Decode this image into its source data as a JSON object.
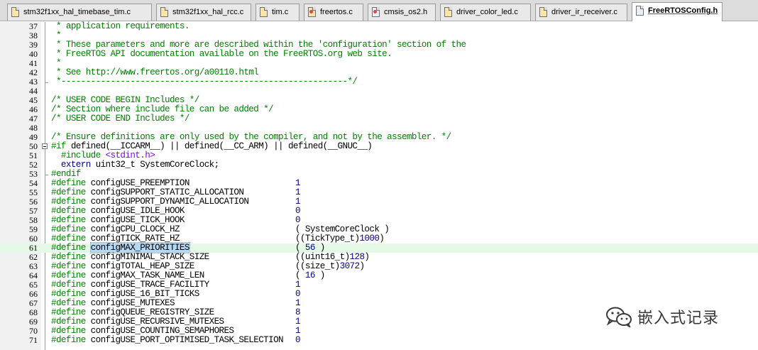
{
  "tabs": [
    {
      "label": "stm32f1xx_hal_timebase_tim.c",
      "type": "c",
      "pin": false,
      "active": false
    },
    {
      "label": "stm32f1xx_hal_rcc.c",
      "type": "c",
      "pin": false,
      "active": false
    },
    {
      "label": "tim.c",
      "type": "c",
      "pin": false,
      "active": false
    },
    {
      "label": "freertos.c",
      "type": "c",
      "pin": true,
      "active": false
    },
    {
      "label": "cmsis_os2.h",
      "type": "h",
      "pin": true,
      "active": false
    },
    {
      "label": "driver_color_led.c",
      "type": "c",
      "pin": false,
      "active": false
    },
    {
      "label": "driver_ir_receiver.c",
      "type": "c",
      "pin": false,
      "active": false
    },
    {
      "label": "FreeRTOSConfig.h",
      "type": "h",
      "pin": false,
      "active": true
    }
  ],
  "editor": {
    "highlighted_line": "61",
    "lines": [
      {
        "num": "37",
        "parts": [
          {
            "t": " * application requirements.",
            "c": "cm"
          }
        ]
      },
      {
        "num": "38",
        "parts": [
          {
            "t": " *",
            "c": "cm"
          }
        ]
      },
      {
        "num": "39",
        "parts": [
          {
            "t": " * These parameters and more are described within the 'configuration' section of the",
            "c": "cm"
          }
        ]
      },
      {
        "num": "40",
        "parts": [
          {
            "t": " * FreeRTOS API documentation available on the FreeRTOS.org web site.",
            "c": "cm"
          }
        ]
      },
      {
        "num": "41",
        "parts": [
          {
            "t": " *",
            "c": "cm"
          }
        ]
      },
      {
        "num": "42",
        "parts": [
          {
            "t": " * See http://www.freertos.org/a00110.html",
            "c": "cm"
          }
        ]
      },
      {
        "num": "43",
        "parts": [
          {
            "t": " *----------------------------------------------------------*/",
            "c": "cm"
          }
        ]
      },
      {
        "num": "44",
        "parts": []
      },
      {
        "num": "45",
        "parts": [
          {
            "t": "/* USER CODE BEGIN Includes */",
            "c": "cm"
          }
        ]
      },
      {
        "num": "46",
        "parts": [
          {
            "t": "/* Section where include file can be added */",
            "c": "cm"
          }
        ]
      },
      {
        "num": "47",
        "parts": [
          {
            "t": "/* USER CODE END Includes */",
            "c": "cm"
          }
        ]
      },
      {
        "num": "48",
        "parts": []
      },
      {
        "num": "49",
        "parts": [
          {
            "t": "/* Ensure definitions are only used by the compiler, and not by the assembler. */",
            "c": "cm"
          }
        ]
      },
      {
        "num": "50",
        "parts": [
          {
            "t": "#if",
            "c": "pp"
          },
          {
            "t": " defined(__ICCARM__) || defined(__CC_ARM) || defined(__GNUC__)",
            "c": ""
          }
        ]
      },
      {
        "num": "51",
        "parts": [
          {
            "t": "  #include ",
            "c": "pp"
          },
          {
            "t": "<stdint.h>",
            "c": "inc"
          }
        ]
      },
      {
        "num": "52",
        "parts": [
          {
            "t": "  extern",
            "c": "dir"
          },
          {
            "t": " uint32_t SystemCoreClock;",
            "c": ""
          }
        ]
      },
      {
        "num": "53",
        "parts": [
          {
            "t": "#endif",
            "c": "pp"
          }
        ]
      },
      {
        "num": "54",
        "parts": [
          {
            "t": "#define",
            "c": "pp"
          },
          {
            "t": " configUSE_PREEMPTION",
            "c": ""
          }
        ],
        "value": [
          {
            "t": "1",
            "c": "num"
          }
        ]
      },
      {
        "num": "55",
        "parts": [
          {
            "t": "#define",
            "c": "pp"
          },
          {
            "t": " configSUPPORT_STATIC_ALLOCATION",
            "c": ""
          }
        ],
        "value": [
          {
            "t": "1",
            "c": "num"
          }
        ]
      },
      {
        "num": "56",
        "parts": [
          {
            "t": "#define",
            "c": "pp"
          },
          {
            "t": " configSUPPORT_DYNAMIC_ALLOCATION",
            "c": ""
          }
        ],
        "value": [
          {
            "t": "1",
            "c": "num"
          }
        ]
      },
      {
        "num": "57",
        "parts": [
          {
            "t": "#define",
            "c": "pp"
          },
          {
            "t": " configUSE_IDLE_HOOK",
            "c": ""
          }
        ],
        "value": [
          {
            "t": "0",
            "c": "num"
          }
        ]
      },
      {
        "num": "58",
        "parts": [
          {
            "t": "#define",
            "c": "pp"
          },
          {
            "t": " configUSE_TICK_HOOK",
            "c": ""
          }
        ],
        "value": [
          {
            "t": "0",
            "c": "num"
          }
        ]
      },
      {
        "num": "59",
        "parts": [
          {
            "t": "#define",
            "c": "pp"
          },
          {
            "t": " configCPU_CLOCK_HZ",
            "c": ""
          }
        ],
        "value": [
          {
            "t": "( SystemCoreClock )",
            "c": ""
          }
        ]
      },
      {
        "num": "60",
        "parts": [
          {
            "t": "#define",
            "c": "pp"
          },
          {
            "t": " configTICK_RATE_HZ",
            "c": ""
          }
        ],
        "value": [
          {
            "t": "((TickType_t)",
            "c": ""
          },
          {
            "t": "1000",
            "c": "num"
          },
          {
            "t": ")",
            "c": ""
          }
        ]
      },
      {
        "num": "61",
        "parts": [
          {
            "t": "#define",
            "c": "pp"
          },
          {
            "t": " ",
            "c": ""
          },
          {
            "t": "configMAX_PRIORITIES",
            "c": "sel"
          }
        ],
        "value": [
          {
            "t": "( ",
            "c": ""
          },
          {
            "t": "56",
            "c": "num"
          },
          {
            "t": " )",
            "c": ""
          }
        ]
      },
      {
        "num": "62",
        "parts": [
          {
            "t": "#define",
            "c": "pp"
          },
          {
            "t": " configMINIMAL_STACK_SIZE",
            "c": ""
          }
        ],
        "value": [
          {
            "t": "((uint16_t)",
            "c": ""
          },
          {
            "t": "128",
            "c": "num"
          },
          {
            "t": ")",
            "c": ""
          }
        ]
      },
      {
        "num": "63",
        "parts": [
          {
            "t": "#define",
            "c": "pp"
          },
          {
            "t": " configTOTAL_HEAP_SIZE",
            "c": ""
          }
        ],
        "value": [
          {
            "t": "((size_t)",
            "c": ""
          },
          {
            "t": "3072",
            "c": "num"
          },
          {
            "t": ")",
            "c": ""
          }
        ]
      },
      {
        "num": "64",
        "parts": [
          {
            "t": "#define",
            "c": "pp"
          },
          {
            "t": " configMAX_TASK_NAME_LEN",
            "c": ""
          }
        ],
        "value": [
          {
            "t": "( ",
            "c": ""
          },
          {
            "t": "16",
            "c": "num"
          },
          {
            "t": " )",
            "c": ""
          }
        ]
      },
      {
        "num": "65",
        "parts": [
          {
            "t": "#define",
            "c": "pp"
          },
          {
            "t": " configUSE_TRACE_FACILITY",
            "c": ""
          }
        ],
        "value": [
          {
            "t": "1",
            "c": "num"
          }
        ]
      },
      {
        "num": "66",
        "parts": [
          {
            "t": "#define",
            "c": "pp"
          },
          {
            "t": " configUSE_16_BIT_TICKS",
            "c": ""
          }
        ],
        "value": [
          {
            "t": "0",
            "c": "num"
          }
        ]
      },
      {
        "num": "67",
        "parts": [
          {
            "t": "#define",
            "c": "pp"
          },
          {
            "t": " configUSE_MUTEXES",
            "c": ""
          }
        ],
        "value": [
          {
            "t": "1",
            "c": "num"
          }
        ]
      },
      {
        "num": "68",
        "parts": [
          {
            "t": "#define",
            "c": "pp"
          },
          {
            "t": " configQUEUE_REGISTRY_SIZE",
            "c": ""
          }
        ],
        "value": [
          {
            "t": "8",
            "c": "num"
          }
        ]
      },
      {
        "num": "69",
        "parts": [
          {
            "t": "#define",
            "c": "pp"
          },
          {
            "t": " configUSE_RECURSIVE_MUTEXES",
            "c": ""
          }
        ],
        "value": [
          {
            "t": "1",
            "c": "num"
          }
        ]
      },
      {
        "num": "70",
        "parts": [
          {
            "t": "#define",
            "c": "pp"
          },
          {
            "t": " configUSE_COUNTING_SEMAPHORES",
            "c": ""
          }
        ],
        "value": [
          {
            "t": "1",
            "c": "num"
          }
        ]
      },
      {
        "num": "71",
        "parts": [
          {
            "t": "#define",
            "c": "pp"
          },
          {
            "t": " configUSE_PORT_OPTIMISED_TASK_SELECTION",
            "c": ""
          }
        ],
        "value": [
          {
            "t": "0",
            "c": "num"
          }
        ]
      }
    ]
  },
  "watermark": {
    "icon": "wechat-icon",
    "text": "嵌入式记录"
  }
}
